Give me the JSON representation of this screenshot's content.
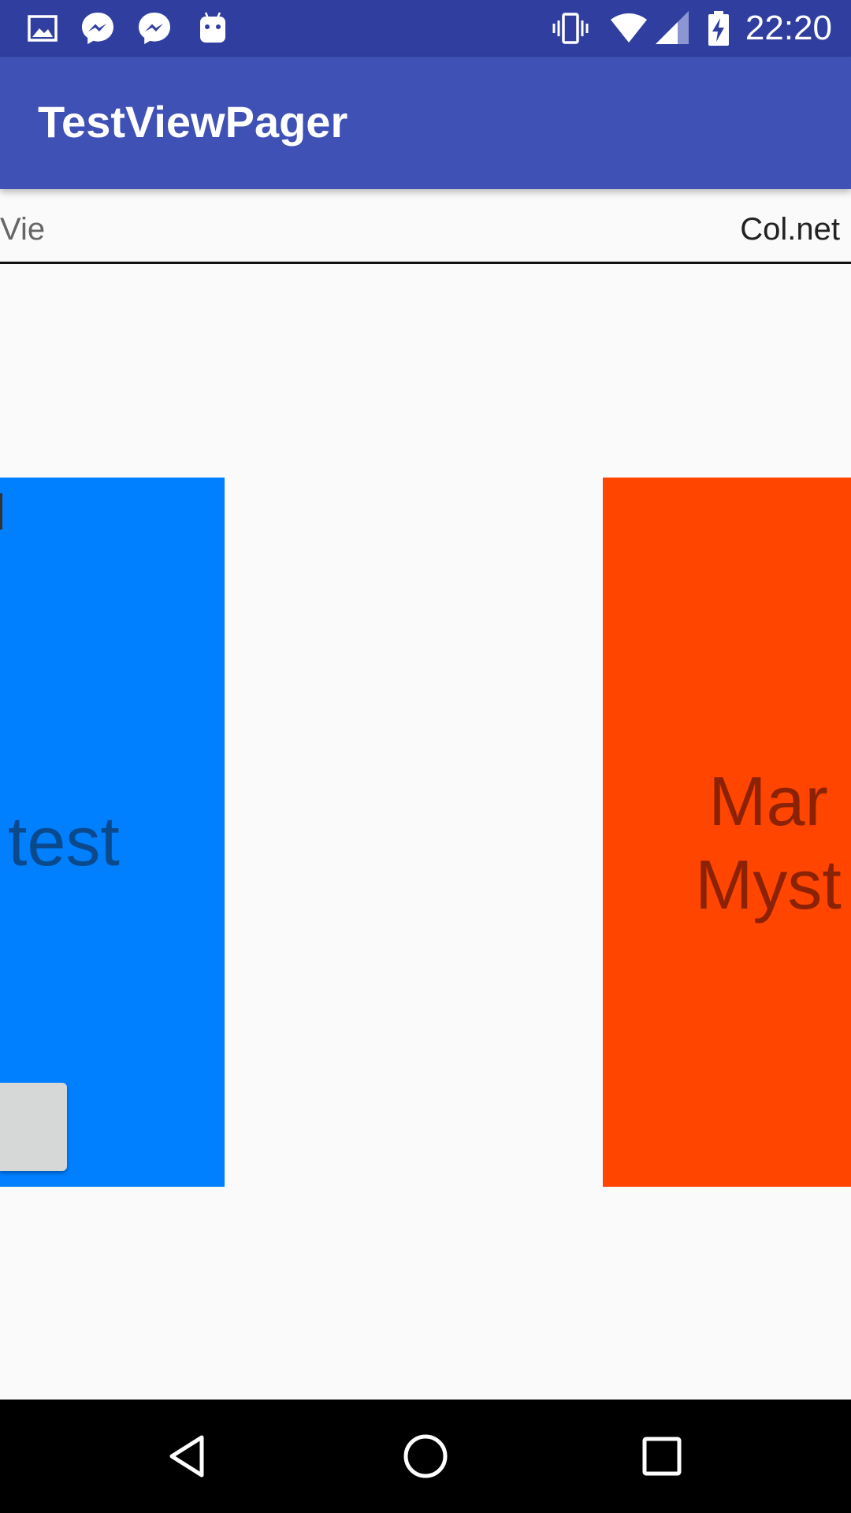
{
  "status_bar": {
    "time": "22:20",
    "left_icons": [
      "gallery-icon",
      "messenger-icon",
      "messenger-icon",
      "android-icon"
    ],
    "right_icons": [
      "vibrate-icon",
      "wifi-icon",
      "cell-signal-icon",
      "battery-charging-icon"
    ],
    "background": "#303f9f"
  },
  "app_bar": {
    "title": "TestViewPager",
    "background": "#3f51b5"
  },
  "tabs": {
    "previous_label": "Vie",
    "current_label": "Col.net"
  },
  "pages": {
    "left_card": {
      "text": "test",
      "color": "#007fff"
    },
    "right_card": {
      "line1": "Mar",
      "line2": "Myst",
      "color": "#ff4500"
    }
  },
  "nav_bar": {
    "buttons": [
      "back-icon",
      "home-icon",
      "recents-icon"
    ]
  }
}
